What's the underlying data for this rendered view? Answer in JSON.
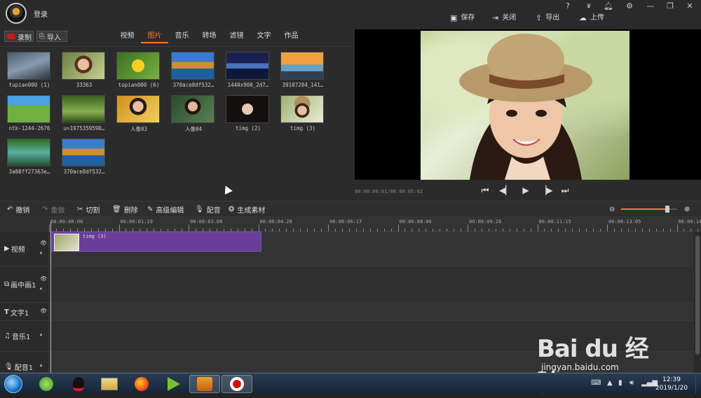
{
  "titlebar": {
    "login": "登录",
    "window_controls": [
      "?",
      "VIP",
      "bell",
      "gear",
      "minimize",
      "restore",
      "close"
    ],
    "actions": [
      {
        "label": "保存",
        "icon": "save-icon"
      },
      {
        "label": "关闭",
        "icon": "exit-icon"
      },
      {
        "label": "导出",
        "icon": "export-icon"
      },
      {
        "label": "上传",
        "icon": "upload-icon"
      }
    ]
  },
  "media": {
    "record_label": "录制",
    "import_label": "导入",
    "tabs": [
      "视频",
      "图片",
      "音乐",
      "转场",
      "滤镜",
      "文字",
      "作品"
    ],
    "active_tab": "图片",
    "items": [
      {
        "caption": "tupian000 (1)"
      },
      {
        "caption": "33363"
      },
      {
        "caption": "tupian000 (6)"
      },
      {
        "caption": "370ace8df532…"
      },
      {
        "caption": "1440x900_2d7…"
      },
      {
        "caption": "39107284_141…"
      },
      {
        "caption": "ntk-1244-2676"
      },
      {
        "caption": "u=1975359590…"
      },
      {
        "caption": "人像03"
      },
      {
        "caption": "人像04"
      },
      {
        "caption": "timg (2)"
      },
      {
        "caption": "timg (3)"
      },
      {
        "caption": "3a88ff27363e…"
      },
      {
        "caption": "370ace8df532…"
      }
    ]
  },
  "preview": {
    "time": "00:00:00:01/00:00:05:02"
  },
  "toolbar": {
    "undo": "撤销",
    "redo": "重做",
    "cut": "切割",
    "delete": "删除",
    "advanced_edit": "高级编辑",
    "voiceover": "配音",
    "generate": "生成素材",
    "zoom_level": 0.82
  },
  "timeline": {
    "ticks": [
      "00:00:00:00",
      "00:00:01:19",
      "00:00:03:08",
      "00:00:04:28",
      "00:00:06:17",
      "00:00:08:06",
      "00:00:09:26",
      "00:00:11:15",
      "00:00:13:05",
      "00:00:14:"
    ],
    "tracks": [
      {
        "label": "视频",
        "icon": "play-icon"
      },
      {
        "label": "画中画1",
        "icon": "pip-icon"
      },
      {
        "label": "文字1",
        "icon": "text-icon"
      },
      {
        "label": "音乐1",
        "icon": "music-icon"
      },
      {
        "label": "配音1",
        "icon": "mic-icon"
      }
    ],
    "clip_name": "timg (3)"
  },
  "watermark": {
    "brand": "Bai du 经验",
    "url": "jingyan.baidu.com"
  },
  "taskbar": {
    "time": "12:39",
    "date": "2019/1/20"
  }
}
